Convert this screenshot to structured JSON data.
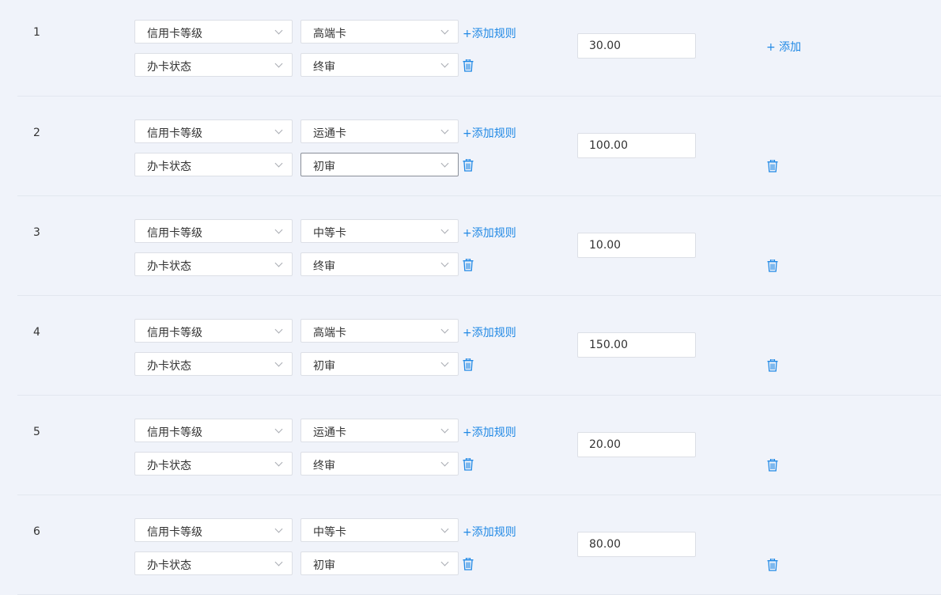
{
  "accent_color": "#1f88e5",
  "add_rule_label": "+添加规则",
  "add_label": "+ 添加",
  "rows": [
    {
      "index": "1",
      "rule1_field": "信用卡等级",
      "rule1_value": "高端卡",
      "rule2_field": "办卡状态",
      "rule2_value": "终审",
      "amount": "30.00"
    },
    {
      "index": "2",
      "rule1_field": "信用卡等级",
      "rule1_value": "运通卡",
      "rule2_field": "办卡状态",
      "rule2_value": "初审",
      "amount": "100.00"
    },
    {
      "index": "3",
      "rule1_field": "信用卡等级",
      "rule1_value": "中等卡",
      "rule2_field": "办卡状态",
      "rule2_value": "终审",
      "amount": "10.00"
    },
    {
      "index": "4",
      "rule1_field": "信用卡等级",
      "rule1_value": "高端卡",
      "rule2_field": "办卡状态",
      "rule2_value": "初审",
      "amount": "150.00"
    },
    {
      "index": "5",
      "rule1_field": "信用卡等级",
      "rule1_value": "运通卡",
      "rule2_field": "办卡状态",
      "rule2_value": "终审",
      "amount": "20.00"
    },
    {
      "index": "6",
      "rule1_field": "信用卡等级",
      "rule1_value": "中等卡",
      "rule2_field": "办卡状态",
      "rule2_value": "初审",
      "amount": "80.00"
    }
  ],
  "icons": {
    "chevron": "chevron-down-icon",
    "delete": "trash-icon"
  }
}
